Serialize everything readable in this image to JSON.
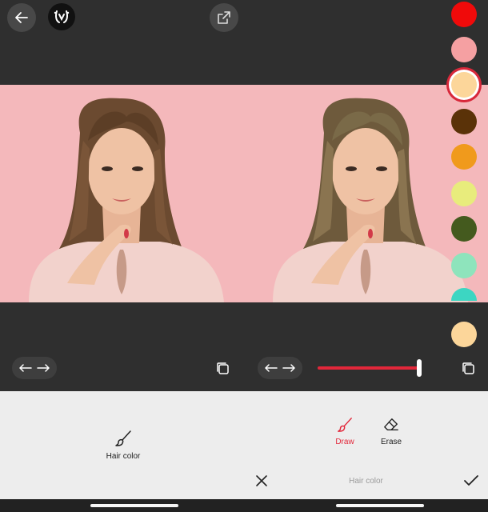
{
  "left_panel": {
    "toolbar": {
      "back_icon": "arrow-left-icon",
      "logo_icon": "app-logo-icon",
      "share_icon": "share-icon"
    },
    "compare_icon": "arrows-left-right-icon",
    "layer_icon": "layers-icon",
    "tool": {
      "icon": "brush-icon",
      "label": "Hair color"
    }
  },
  "right_panel": {
    "compare_icon": "arrows-left-right-icon",
    "layer_icon": "layers-icon",
    "slider": {
      "value": 1.0,
      "color": "#e2273a"
    },
    "tools": [
      {
        "icon": "brush-icon",
        "label": "Draw",
        "active": true
      },
      {
        "icon": "eraser-icon",
        "label": "Erase",
        "active": false
      }
    ],
    "mode_title": "Hair color",
    "cancel_icon": "close-icon",
    "confirm_icon": "checkmark-icon"
  },
  "swatches": {
    "colors": [
      "#f00a0a",
      "#f5a0a2",
      "#fcd69a",
      "#5a3208",
      "#f09a1c",
      "#e8ec7c",
      "#445a1e",
      "#8ee4bc",
      "#3cd6c2",
      "#fcd69a"
    ],
    "selected_index": 2
  },
  "accent_color": "#e2273a"
}
